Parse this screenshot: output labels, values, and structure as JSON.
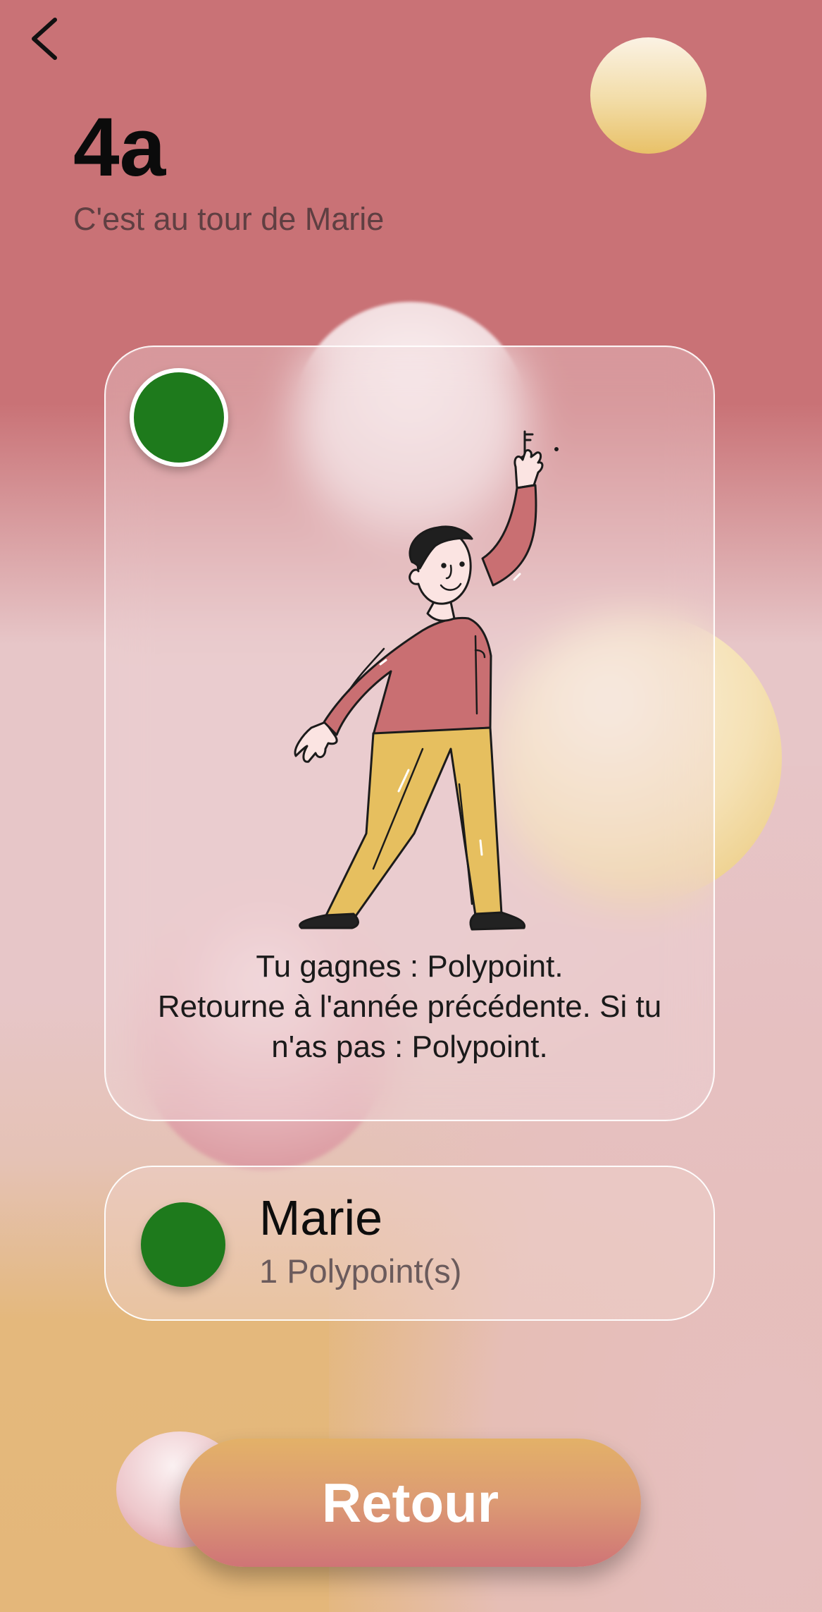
{
  "header": {
    "back_icon": "chevron-left-icon",
    "title": "4a",
    "subtitle": "C'est au tour de Marie"
  },
  "card": {
    "dot_color": "#1e7a1c",
    "illustration": "man-holding-key-illustration",
    "text_lines": [
      "Tu gagnes : Polypoint.",
      "Retourne à l'année précédente. Si tu",
      "n'as pas : Polypoint."
    ]
  },
  "player": {
    "name": "Marie",
    "points": "1 Polypoint(s)",
    "color": "#1e7a1c"
  },
  "footer": {
    "retour_label": "Retour"
  },
  "colors": {
    "background_top": "#c97276",
    "background_bottom": "#e4b77a",
    "button_gradient_top": "#e3b168",
    "button_gradient_bottom": "#cf7476"
  }
}
